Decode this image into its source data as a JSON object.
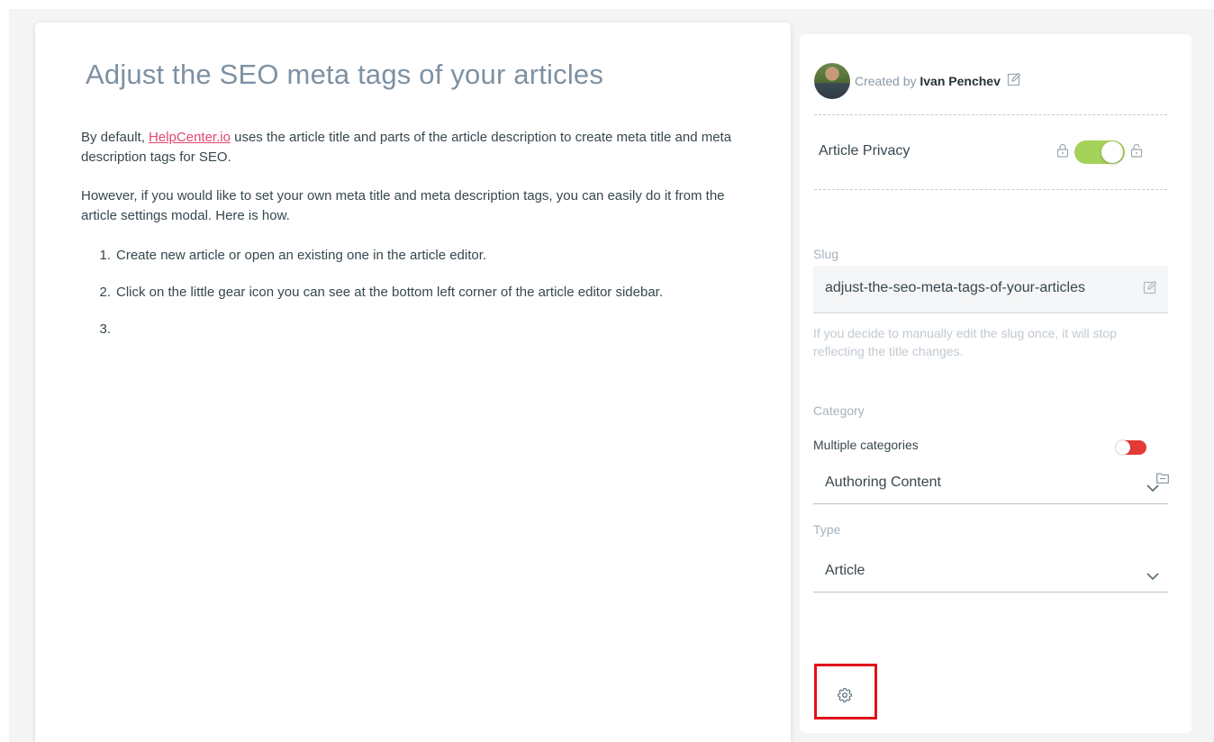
{
  "article": {
    "title": "Adjust the SEO meta tags of your articles",
    "p1_before": "By default, ",
    "p1_link": "HelpCenter.io",
    "p1_after": " uses the article title and parts of the article description to create meta title and meta description tags for SEO.",
    "p2": "However, if you would like to set your own meta title and meta description tags, you can easily do it from the article settings modal. Here is how.",
    "steps": [
      {
        "num": "1.",
        "text": "Create new article or open an existing one in the article editor."
      },
      {
        "num": "2.",
        "text": "Click on the little gear icon you can see at the bottom left corner of the article editor sidebar."
      },
      {
        "num": "3.",
        "text": ""
      }
    ]
  },
  "sidebar": {
    "created_by_label": "Created by",
    "author": "Ivan Penchev",
    "privacy_label": "Article Privacy",
    "privacy_on": true,
    "slug_label": "Slug",
    "slug_value": "adjust-the-seo-meta-tags-of-your-articles",
    "slug_help": "If you decide to manually edit the slug once, it will stop reflecting the title changes.",
    "category_label": "Category",
    "multiple_categories_label": "Multiple categories",
    "multiple_categories_on": false,
    "category_value": "Authoring Content",
    "type_label": "Type",
    "type_value": "Article"
  },
  "colors": {
    "accent_link": "#e2466d",
    "toggle_on": "#a5d25a",
    "toggle_off": "#e53935",
    "highlight_box": "#e0111c",
    "title": "#7d91a3"
  },
  "icons": [
    "edit-icon",
    "lock-icon",
    "unlock-icon",
    "chevron-down-icon",
    "folder-icon",
    "gear-icon"
  ]
}
